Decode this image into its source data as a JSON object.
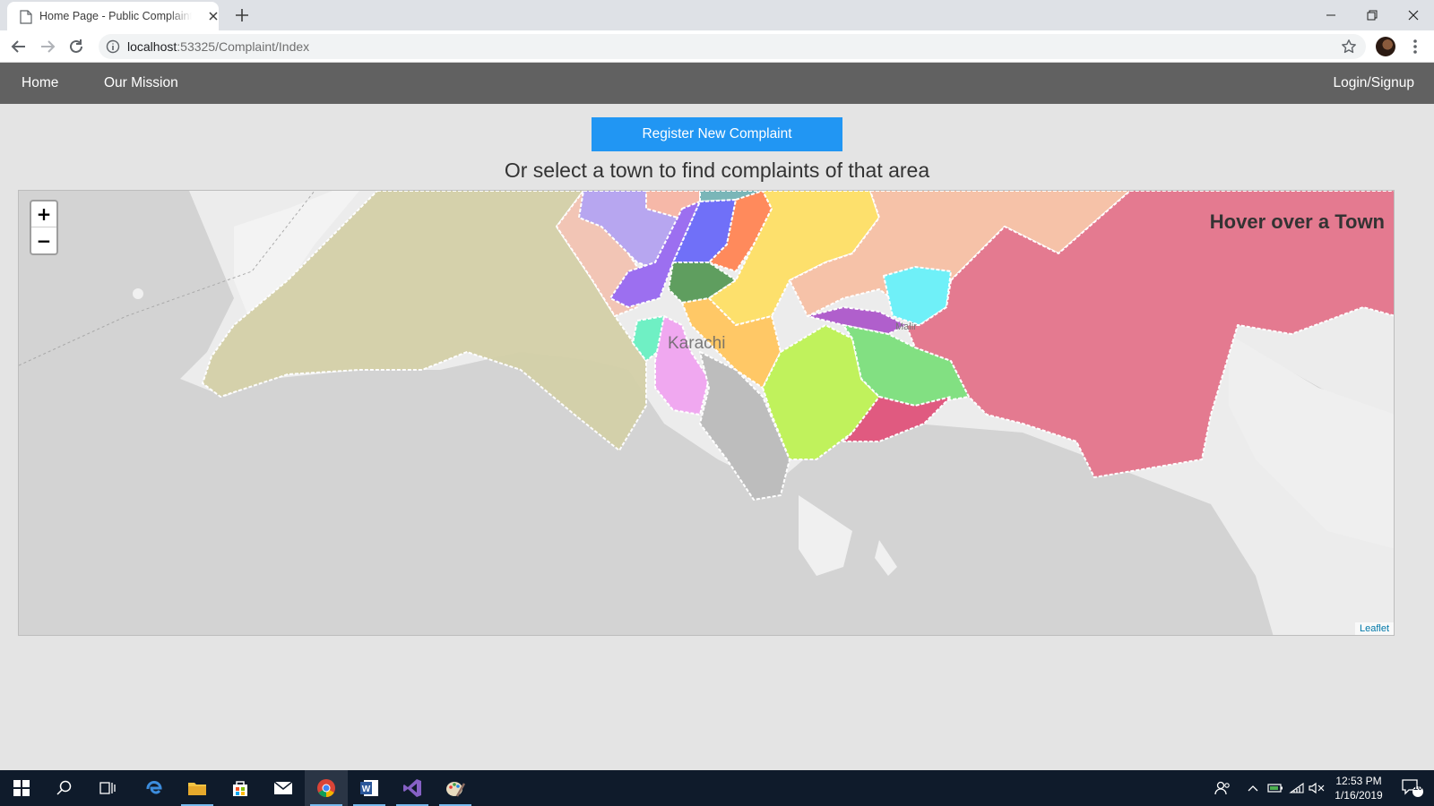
{
  "browser": {
    "tab_title": "Home Page - Public Complaint Portal",
    "url_host": "localhost",
    "url_rest": ":53325/Complaint/Index"
  },
  "nav": {
    "home": "Home",
    "mission": "Our Mission",
    "login": "Login/Signup"
  },
  "page": {
    "register_label": "Register New Complaint",
    "subtitle": "Or select a town to find complaints of that area"
  },
  "map": {
    "zoom_in": "+",
    "zoom_out": "−",
    "info": "Hover over a Town",
    "city": "Karachi",
    "town_label": "Malir",
    "attribution": "Leaflet"
  },
  "taskbar": {
    "time": "12:53 PM",
    "date": "1/16/2019",
    "notifications": "10"
  },
  "colors": {
    "accent": "#2196f3",
    "navbar": "#616161",
    "taskbar": "#0f1b2b"
  }
}
